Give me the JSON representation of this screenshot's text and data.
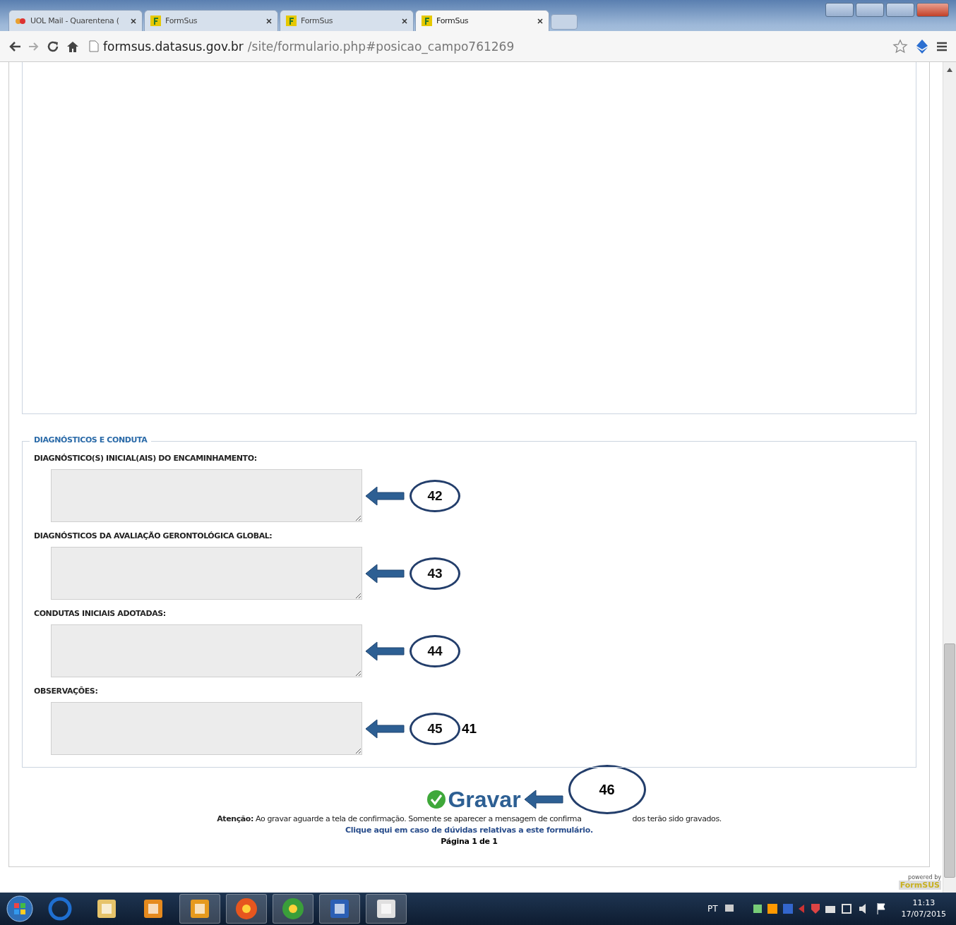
{
  "browser": {
    "tabs": [
      {
        "title": "UOL Mail - Quarentena (",
        "selected": false
      },
      {
        "title": "FormSus",
        "selected": false
      },
      {
        "title": "FormSus",
        "selected": false
      },
      {
        "title": "FormSus",
        "selected": true
      }
    ],
    "url_host": "formsus.datasus.gov.br",
    "url_path": "/site/formulario.php#posicao_campo761269"
  },
  "form": {
    "section_title": "DIAGNÓSTICOS E CONDUTA",
    "fields": [
      {
        "label": "DIAGNÓSTICO(S) INICIAL(AIS) DO ENCAMINHAMENTO:",
        "callout": "42"
      },
      {
        "label": "DIAGNÓSTICOS DA AVALIAÇÃO GERONTOLÓGICA GLOBAL:",
        "callout": "43"
      },
      {
        "label": "CONDUTAS INICIAIS ADOTADAS:",
        "callout": "44"
      },
      {
        "label": "OBSERVAÇÕES:",
        "callout": "45",
        "extra": "41"
      }
    ],
    "submit": {
      "label": "Gravar",
      "callout": "46"
    },
    "notice_part1": "**Atenção:** Ao gravar aguarde a tela de confirmação. Somente se aparecer a mensagem de confirma",
    "notice_part2": "dos terão sido gravados.",
    "help_link": "Clique aqui em caso de dúvidas relativas a este formulário.",
    "page_label": "Página 1 de 1",
    "powered_by": "powered by",
    "brand": "FormSUS"
  },
  "taskbar": {
    "language": "PT",
    "time": "11:13",
    "date": "17/07/2015"
  }
}
